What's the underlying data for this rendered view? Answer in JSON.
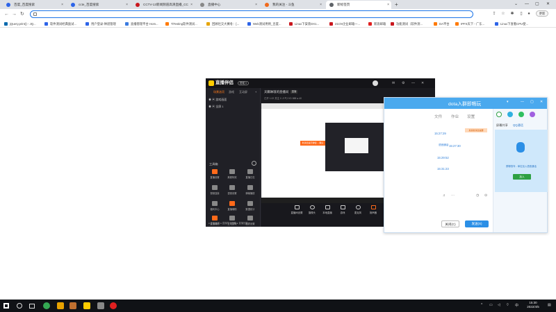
{
  "browser": {
    "tabs": [
      {
        "label": "百度_百度搜索",
        "color": "#2d64e8"
      },
      {
        "label": "ccte_百度搜索",
        "color": "#2d64e8"
      },
      {
        "label": "CCTV-13新闻频道高清直播_CC",
        "color": "#c9171e"
      },
      {
        "label": "直播中心",
        "color": "#888888"
      },
      {
        "label": "我的关注 - 斗鱼",
        "color": "#f06a1c"
      },
      {
        "label": "新标签页",
        "color": "#5f6368"
      }
    ],
    "new_tab": "+",
    "omnibox_value": "",
    "profile_label": "更新",
    "bookmarks": [
      {
        "label": "jQuery.print() - JQ...",
        "color": "#0769ad"
      },
      {
        "label": "软件测试经典面试...",
        "color": "#2d64e8"
      },
      {
        "label": "用户登录-禅道管理",
        "color": "#2d64e8"
      },
      {
        "label": "直播管理平台 Hom...",
        "color": "#3b7be0"
      },
      {
        "label": "TiTesting软件测试...",
        "color": "#ff7a00"
      },
      {
        "label": "回顾社交大赛冬：[...",
        "color": "#e6a400"
      },
      {
        "label": "Web测试用例_百度...",
        "color": "#2d64e8"
      },
      {
        "label": "Linux下安装DX1...",
        "color": "#c9171e"
      },
      {
        "label": "21CN企业邮箱一...",
        "color": "#c9171e"
      },
      {
        "label": "新浪邮箱",
        "color": "#e02020"
      },
      {
        "label": "功能测试（软件测...",
        "color": "#c9171e"
      },
      {
        "label": "DA平台",
        "color": "#ff7a00"
      },
      {
        "label": "IPFS天下 - 广东...",
        "color": "#ff7a00"
      },
      {
        "label": "Linux下查看CPU使...",
        "color": "#2d64e8"
      }
    ]
  },
  "live_app": {
    "title": "直播伴侣",
    "badge": "帮助 ▾",
    "scene_tabs": [
      "场景选项",
      "游戏",
      "互动屏"
    ],
    "sources": [
      "游戏画面",
      "全屏 1"
    ],
    "tools_header": "工具箱",
    "tools": [
      {
        "label": "直播设置",
        "color": "#ff6a1a"
      },
      {
        "label": "美颜特效",
        "color": "#888888"
      },
      {
        "label": "直播日志",
        "color": "#888888"
      },
      {
        "label": "视频连接",
        "color": "#888888"
      },
      {
        "label": "语音设置",
        "color": "#888888"
      },
      {
        "label": "弹幕播放",
        "color": "#888888"
      },
      {
        "label": "福利中心",
        "color": "#888888"
      },
      {
        "label": "直播辅助",
        "color": "#ff6a1a"
      },
      {
        "label": "数据统计",
        "color": "#888888"
      },
      {
        "label": "直播辅助",
        "color": "#ff6a1a"
      },
      {
        "label": "互动游戏",
        "color": "#888888"
      },
      {
        "label": "画质设置",
        "color": "#888888"
      }
    ],
    "status": "● 正在互动 ● 直播打卡配置 ● 直播回放",
    "preview_title": "天籁琳琅的直播间",
    "preview_tag": "直播",
    "preview_meta": "已开 1:22  关注 0  人气 0  ID 888  ● 40",
    "controls": [
      "直播间设置",
      "摄像头",
      "本地直播",
      "游戏",
      "麦克风",
      "扬声器"
    ],
    "start_label": "开始直播",
    "footer": "CPU 0%   内存 45%   FPS",
    "canvas_orange": "新消息提示弹窗 -- 确认"
  },
  "chat": {
    "title": "dota入群即畅玩",
    "tabs": [
      "文件",
      "作业",
      "设置"
    ],
    "times": [
      "15:27:29",
      "15:27:30",
      "15:29:52",
      "15:31:23"
    ],
    "orange_msg": "某某新消息提醒",
    "blue_msg": "语音通话",
    "side_labels": [
      "屏幕共享",
      "QQ通话"
    ],
    "mic_hint": "群聊快车 - 单击加入语音通话",
    "join_label": "加入",
    "close_label": "关闭(C)",
    "send_label": "发送(S)"
  },
  "taskbar": {
    "time": "15:30",
    "date": "2022/4/5",
    "lang": "中",
    "icons": [
      {
        "name": "start-icon",
        "color": "#ffffff"
      },
      {
        "name": "search-icon",
        "color": "#dddddd"
      },
      {
        "name": "taskview-icon",
        "color": "#dddddd"
      },
      {
        "name": "chrome-icon",
        "color": "#34a853"
      },
      {
        "name": "app-icon",
        "color": "#e8a200"
      },
      {
        "name": "game-icon",
        "color": "#c07030"
      },
      {
        "name": "live-icon",
        "color": "#ffcc00"
      },
      {
        "name": "media-icon",
        "color": "#888888"
      },
      {
        "name": "red-app-icon",
        "color": "#e02020"
      }
    ]
  }
}
